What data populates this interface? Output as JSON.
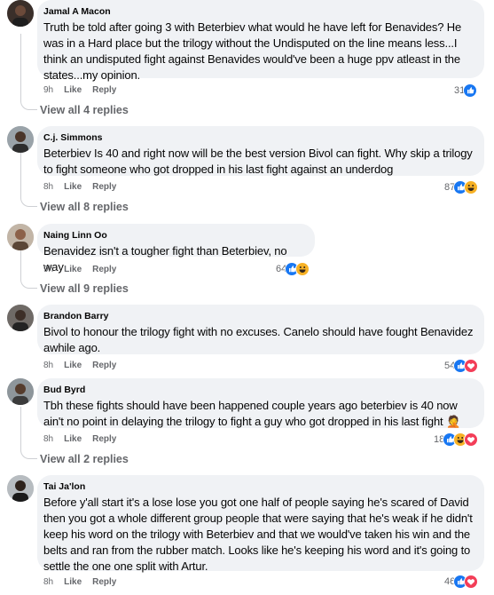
{
  "comments": [
    {
      "author": "Jamal A Macon",
      "text": "Truth be told after going 3 with Beterbiev what would he have left for Benavides? He was in a Hard place but the trilogy without the Undisputed on the line means less...I think an undisputed fight against Benavides would've been a huge ppv atleast in the states...my opinion.",
      "time": "9h",
      "like": "Like",
      "reply": "Reply",
      "reactions": "31",
      "reaction_icons": [
        "like-icon"
      ],
      "view_replies": "View all 4 replies"
    },
    {
      "author": "C.j. Simmons",
      "text": "Beterbiev Is 40 and right now will be the best version Bivol can fight. Why skip a trilogy to fight someone who got dropped in his last fight against an underdog",
      "time": "8h",
      "like": "Like",
      "reply": "Reply",
      "reactions": "87",
      "reaction_icons": [
        "like-icon",
        "haha-icon"
      ],
      "view_replies": "View all 8 replies"
    },
    {
      "author": "Naing Linn Oo",
      "text": "Benavidez isn't a tougher fight than Beterbiev, no way",
      "time": "9h",
      "like": "Like",
      "reply": "Reply",
      "reactions": "64",
      "reaction_icons": [
        "like-icon",
        "haha-icon"
      ],
      "view_replies": "View all 9 replies"
    },
    {
      "author": "Brandon Barry",
      "text": "Bivol to honour the trilogy fight with no excuses. Canelo should have fought Benavidez awhile ago.",
      "time": "8h",
      "like": "Like",
      "reply": "Reply",
      "reactions": "54",
      "reaction_icons": [
        "like-icon",
        "love-icon"
      ],
      "view_replies": ""
    },
    {
      "author": "Bud Byrd",
      "text": "Tbh these fights should have been happened couple years ago beterbiev is 40 now ain't no point in delaying the trilogy to fight a guy who got dropped in his last fight 🤦",
      "time": "8h",
      "like": "Like",
      "reply": "Reply",
      "reactions": "18",
      "reaction_icons": [
        "like-icon",
        "haha-icon",
        "love-icon"
      ],
      "view_replies": "View all 2 replies"
    },
    {
      "author": "Tai Ja'lon",
      "text": "Before y'all start it's a lose lose you got one half of people saying he's scared of David then you got a whole different group people that were saying that he's weak if he didn't keep his word on the trilogy with Beterbiev and that we would've taken his win and the belts and ran from the rubber match. Looks like he's keeping his word and it's going to settle the one one split with Artur.",
      "time": "8h",
      "like": "Like",
      "reply": "Reply",
      "reactions": "46",
      "reaction_icons": [
        "like-icon",
        "love-icon"
      ],
      "view_replies": ""
    }
  ],
  "colors": {
    "like": "#1877f2",
    "love": "#f33e58",
    "haha": "#f7b125",
    "meta": "#65676b",
    "bubble": "#f0f2f5"
  }
}
